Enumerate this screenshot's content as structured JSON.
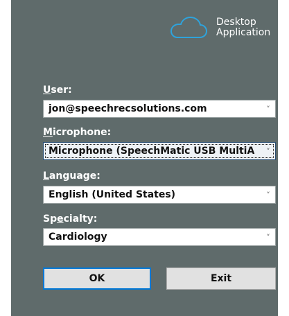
{
  "brand": {
    "line1": "Desktop",
    "line2": "Application",
    "icon": "cloud-icon"
  },
  "fields": {
    "user": {
      "label_accel": "U",
      "label_rest": "ser:",
      "value": "jon@speechrecsolutions.com"
    },
    "microphone": {
      "label_accel": "M",
      "label_rest": "icrophone:",
      "value": "Microphone (SpeechMatic USB MultiA"
    },
    "language": {
      "label_accel": "L",
      "label_rest": "anguage:",
      "value": "English (United States)"
    },
    "specialty": {
      "label_pre": "Sp",
      "label_accel": "e",
      "label_rest": "cialty:",
      "value": "Cardiology"
    }
  },
  "chevron": "˅",
  "buttons": {
    "ok": "OK",
    "exit": "Exit"
  },
  "colors": {
    "panel": "#5f6b6b",
    "default_button_border": "#0078d7"
  }
}
